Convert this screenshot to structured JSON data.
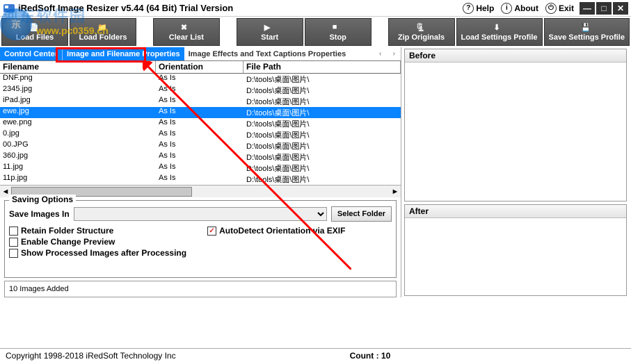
{
  "title": "iRedSoft Image Resizer v5.44 (64 Bit) Trial Version",
  "titlebar_buttons": {
    "help": "Help",
    "about": "About",
    "exit": "Exit"
  },
  "toolbar": [
    {
      "key": "load-files",
      "label": "Load Files"
    },
    {
      "key": "load-folders",
      "label": "Load Folders"
    },
    {
      "key": "clear-list",
      "label": "Clear List"
    },
    {
      "key": "start",
      "label": "Start"
    },
    {
      "key": "stop",
      "label": "Stop"
    },
    {
      "key": "zip-originals",
      "label": "Zip Originals"
    },
    {
      "key": "load-profile",
      "label": "Load Settings Profile"
    },
    {
      "key": "save-profile",
      "label": "Save Settings Profile"
    }
  ],
  "tabs": {
    "items": [
      "Control Center",
      "Image and Filename Properties",
      "Image Effects and Text Captions Properties"
    ],
    "active_index": 1
  },
  "table": {
    "headers": {
      "filename": "Filename",
      "orientation": "Orientation",
      "filepath": "File Path"
    },
    "rows": [
      {
        "fn": "DNF.png",
        "or": "As Is",
        "fp": "D:\\tools\\桌面\\图片\\",
        "sel": false
      },
      {
        "fn": "2345.jpg",
        "or": "As Is",
        "fp": "D:\\tools\\桌面\\图片\\",
        "sel": false
      },
      {
        "fn": "iPad.jpg",
        "or": "As Is",
        "fp": "D:\\tools\\桌面\\图片\\",
        "sel": false
      },
      {
        "fn": "ewe.jpg",
        "or": "As Is",
        "fp": "D:\\tools\\桌面\\图片\\",
        "sel": true
      },
      {
        "fn": "ewe.png",
        "or": "As Is",
        "fp": "D:\\tools\\桌面\\图片\\",
        "sel": false
      },
      {
        "fn": "0.jpg",
        "or": "As Is",
        "fp": "D:\\tools\\桌面\\图片\\",
        "sel": false
      },
      {
        "fn": "00.JPG",
        "or": "As Is",
        "fp": "D:\\tools\\桌面\\图片\\",
        "sel": false
      },
      {
        "fn": "360.jpg",
        "or": "As Is",
        "fp": "D:\\tools\\桌面\\图片\\",
        "sel": false
      },
      {
        "fn": "11.jpg",
        "or": "As Is",
        "fp": "D:\\tools\\桌面\\图片\\",
        "sel": false
      },
      {
        "fn": "11p.jpg",
        "or": "As Is",
        "fp": "D:\\tools\\桌面\\图片\\",
        "sel": false
      }
    ]
  },
  "preview": {
    "before": "Before",
    "after": "After"
  },
  "saving": {
    "legend": "Saving Options",
    "save_in_label": "Save Images In",
    "select_folder": "Select Folder",
    "cb_retain": "Retain Folder Structure",
    "cb_preview": "Enable Change Preview",
    "cb_show": "Show Processed Images after Processing",
    "cb_autodetect": "AutoDetect Orientation via EXIF",
    "autodetect_checked": true
  },
  "status_line": "10 Images Added",
  "footer": {
    "copyright": "Copyright 1998-2018 iRedSoft Technology Inc",
    "count": "Count : 10"
  },
  "watermark": {
    "zh": "河东软件园",
    "url": "www.pc0359.cn"
  }
}
